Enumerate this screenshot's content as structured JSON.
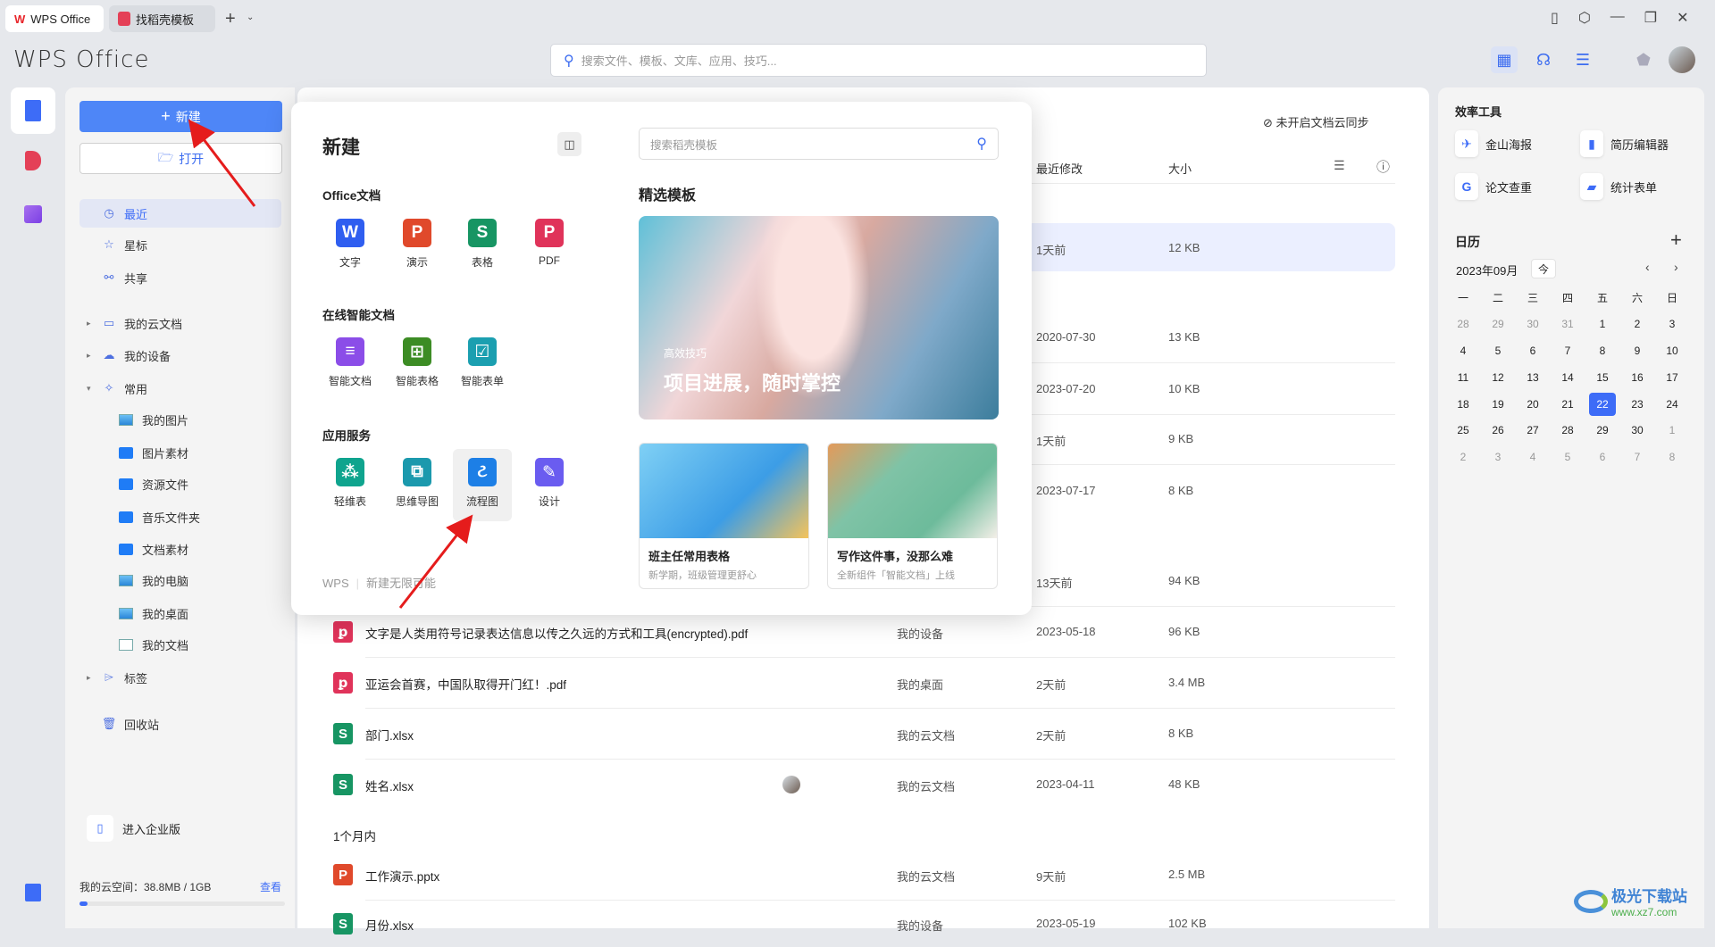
{
  "tabs": [
    {
      "label": "WPS Office",
      "icon": "wps-logo-icon"
    },
    {
      "label": "找稻壳模板",
      "icon": "docer-icon"
    }
  ],
  "logo": "WPS Office",
  "search": {
    "placeholder": "搜索文件、模板、文库、应用、技巧..."
  },
  "sidebar": {
    "new_label": "新建",
    "open_label": "打开",
    "items": [
      {
        "label": "最近",
        "icon": "clock-icon",
        "active": true
      },
      {
        "label": "星标",
        "icon": "star-icon"
      },
      {
        "label": "共享",
        "icon": "share-icon"
      },
      {
        "label": "我的云文档",
        "icon": "folder-icon",
        "expandable": true
      },
      {
        "label": "我的设备",
        "icon": "cloud-upload-icon",
        "expandable": true
      },
      {
        "label": "常用",
        "icon": "pin-icon",
        "expanded": true
      }
    ],
    "common": [
      {
        "label": "我的图片",
        "icon": "picture-icon"
      },
      {
        "label": "图片素材",
        "icon": "folder-icon"
      },
      {
        "label": "资源文件",
        "icon": "folder-icon"
      },
      {
        "label": "音乐文件夹",
        "icon": "folder-icon"
      },
      {
        "label": "文档素材",
        "icon": "folder-icon"
      },
      {
        "label": "我的电脑",
        "icon": "computer-icon"
      },
      {
        "label": "我的桌面",
        "icon": "desktop-icon"
      },
      {
        "label": "我的文档",
        "icon": "document-icon"
      }
    ],
    "tags": "标签",
    "trash": "回收站",
    "enterprise": "进入企业版",
    "storage": {
      "label": "我的云空间：38.8MB / 1GB",
      "link": "查看",
      "used_fraction": 0.038
    }
  },
  "main": {
    "sync_status": "未开启文档云同步",
    "columns": {
      "modified": "最近修改",
      "size": "大小"
    },
    "rows": [
      {
        "modified": "1天前",
        "size": "12 KB",
        "highlight": true
      },
      {
        "modified": "2020-07-30",
        "size": "13 KB"
      },
      {
        "modified": "2023-07-20",
        "size": "10 KB"
      },
      {
        "modified": "1天前",
        "size": "9 KB"
      },
      {
        "modified": "2023-07-17",
        "size": "8 KB"
      },
      {
        "modified": "13天前",
        "size": "94 KB"
      },
      {
        "type": "pdf",
        "name": "文字是人类用符号记录表达信息以传之久远的方式和工具(encrypted).pdf",
        "location": "我的设备",
        "modified": "2023-05-18",
        "size": "96 KB"
      },
      {
        "type": "pdf",
        "name": "亚运会首赛，中国队取得开门红！.pdf",
        "location": "我的桌面",
        "modified": "2天前",
        "size": "3.4 MB"
      },
      {
        "type": "xlsx",
        "name": "部门.xlsx",
        "location": "我的云文档",
        "modified": "2天前",
        "size": "8 KB"
      },
      {
        "type": "xlsx",
        "name": "姓名.xlsx",
        "location": "我的云文档",
        "modified": "2023-04-11",
        "size": "48 KB",
        "shared_avatar": true
      },
      {
        "type": "pptx",
        "name": "工作演示.pptx",
        "location": "我的云文档",
        "modified": "9天前",
        "size": "2.5 MB"
      },
      {
        "type": "xlsx",
        "name": "月份.xlsx",
        "location": "我的设备",
        "modified": "2023-05-19",
        "size": "102 KB"
      }
    ],
    "group_month": "1个月内"
  },
  "popup": {
    "title": "新建",
    "office_title": "Office文档",
    "office": [
      {
        "label": "文字",
        "glyph": "W",
        "color": "#2f5ef0"
      },
      {
        "label": "演示",
        "glyph": "P",
        "color": "#e0492b"
      },
      {
        "label": "表格",
        "glyph": "S",
        "color": "#179563"
      },
      {
        "label": "PDF",
        "glyph": "P",
        "color": "#e0335a"
      }
    ],
    "smart_title": "在线智能文档",
    "smart": [
      {
        "label": "智能文档",
        "glyph": "≡",
        "color": "#8b4de8"
      },
      {
        "label": "智能表格",
        "glyph": "⊞",
        "color": "#3c8c24"
      },
      {
        "label": "智能表单",
        "glyph": "☑",
        "color": "#1b9fb0"
      }
    ],
    "apps_title": "应用服务",
    "apps": [
      {
        "label": "轻维表",
        "glyph": "⁂",
        "color": "#0fa48e"
      },
      {
        "label": "思维导图",
        "glyph": "⧉",
        "color": "#1b99ad"
      },
      {
        "label": "流程图",
        "glyph": "ટ",
        "color": "#1d7fe6",
        "hover": true
      },
      {
        "label": "设计",
        "glyph": "✎",
        "color": "#6a5cf0"
      }
    ],
    "footer_brand": "WPS",
    "footer_text": "新建无限可能",
    "template_search_placeholder": "搜索稻壳模板",
    "featured_title": "精选模板",
    "banner": {
      "tag": "高效技巧",
      "title": "项目进展，随时掌控"
    },
    "cards": [
      {
        "title": "班主任常用表格",
        "subtitle": "新学期，班级管理更舒心"
      },
      {
        "title": "写作这件事，没那么难",
        "subtitle": "全新组件「智能文档」上线"
      }
    ]
  },
  "right": {
    "tools_title": "效率工具",
    "tools": [
      {
        "label": "金山海报",
        "icon": "poster-icon"
      },
      {
        "label": "简历编辑器",
        "icon": "resume-icon"
      },
      {
        "label": "论文查重",
        "icon": "paper-check-icon"
      },
      {
        "label": "统计表单",
        "icon": "form-icon"
      }
    ],
    "calendar_title": "日历",
    "month": "2023年09月",
    "today": "今",
    "weekdays": [
      "一",
      "二",
      "三",
      "四",
      "五",
      "六",
      "日"
    ],
    "weeks": [
      [
        "28",
        "29",
        "30",
        "31",
        "1",
        "2",
        "3"
      ],
      [
        "4",
        "5",
        "6",
        "7",
        "8",
        "9",
        "10"
      ],
      [
        "11",
        "12",
        "13",
        "14",
        "15",
        "16",
        "17"
      ],
      [
        "18",
        "19",
        "20",
        "21",
        "22",
        "23",
        "24"
      ],
      [
        "25",
        "26",
        "27",
        "28",
        "29",
        "30",
        "1"
      ],
      [
        "2",
        "3",
        "4",
        "5",
        "6",
        "7",
        "8"
      ]
    ],
    "selected_day": "22"
  },
  "watermark": {
    "name": "极光下载站",
    "url": "www.xz7.com"
  },
  "colors": {
    "accent": "#3d6cf7",
    "new_button": "#4e86f7",
    "annotation_arrow": "#e51c1c"
  }
}
